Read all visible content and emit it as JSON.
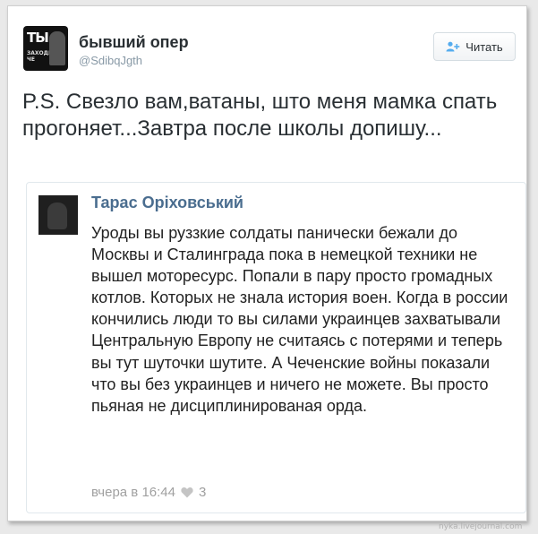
{
  "tweet": {
    "author_name": "бывший опер",
    "author_handle": "@SdibqJgth",
    "avatar_text_big": "ТЫ",
    "avatar_text_small": "ЗАХОДИ\nЧЕ",
    "follow_label": "Читать",
    "text": "P.S. Свезло вам,ватаны, што меня мамка спать прогоняет...Завтра после школы допишу..."
  },
  "quoted_post": {
    "author_name": "Тарас Оріховський",
    "text": "Уроды вы руззкие солдаты панически бежали до Москвы и Сталинграда пока в немецкой техники не вышел моторесурс. Попали в пару просто громадных котлов. Которых не знала история воен. Когда в россии кончились люди то вы силами украинцев захватывали Центральную Европу не считаясь с потерями и теперь вы тут шуточки шутите. А Чеченские войны показали что вы без украинцев и ничего не можете. Вы просто пьяная не дисциплинированая орда.",
    "timestamp": "вчера в 16:44",
    "likes": "3"
  },
  "watermark": "nyka.livejournal.com",
  "colors": {
    "quote_name": "#4a6d8f",
    "handle": "#8899a6",
    "follow_icon": "#55acee"
  }
}
